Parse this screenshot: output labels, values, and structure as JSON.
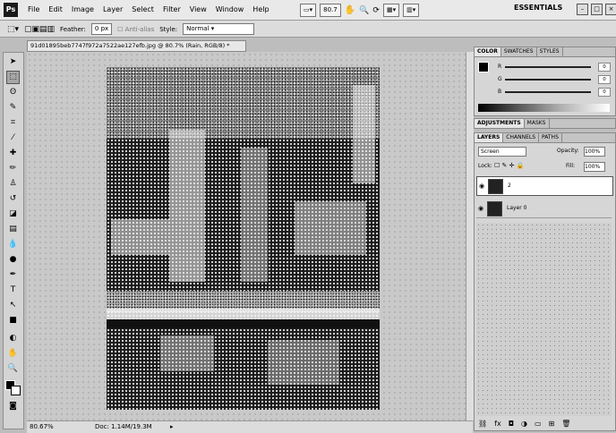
{
  "app": {
    "logo": "Ps",
    "workspace": "ESSENTIALS"
  },
  "menu": [
    "File",
    "Edit",
    "Image",
    "Layer",
    "Select",
    "Filter",
    "View",
    "Window",
    "Help"
  ],
  "menu_tools": {
    "zoom": "80.7"
  },
  "options": {
    "feather_label": "Feather:",
    "feather_value": "0 px",
    "style_label": "Style:",
    "style_value": "Normal"
  },
  "document": {
    "tab_title": "91d01895beb7747f972a7522ae127efb.jpg @ 80.7% (Rain, RGB/8) *"
  },
  "status": {
    "zoom": "80.67%",
    "doc_size": "Doc: 1.14M/19.3M"
  },
  "color_panel": {
    "tabs": [
      "COLOR",
      "SWATCHES",
      "STYLES"
    ],
    "channels": [
      {
        "label": "R",
        "value": "0"
      },
      {
        "label": "G",
        "value": "0"
      },
      {
        "label": "B",
        "value": "0"
      }
    ]
  },
  "adjust_panel": {
    "tabs": [
      "ADJUSTMENTS",
      "MASKS"
    ]
  },
  "layers_panel": {
    "tabs": [
      "LAYERS",
      "CHANNELS",
      "PATHS"
    ],
    "blend_mode": "Screen",
    "opacity_label": "Opacity:",
    "opacity_value": "100%",
    "lock_label": "Lock:",
    "fill_label": "Fill:",
    "fill_value": "100%",
    "layers": [
      {
        "name": "2",
        "selected": true
      },
      {
        "name": "Layer 0",
        "selected": false
      }
    ]
  }
}
